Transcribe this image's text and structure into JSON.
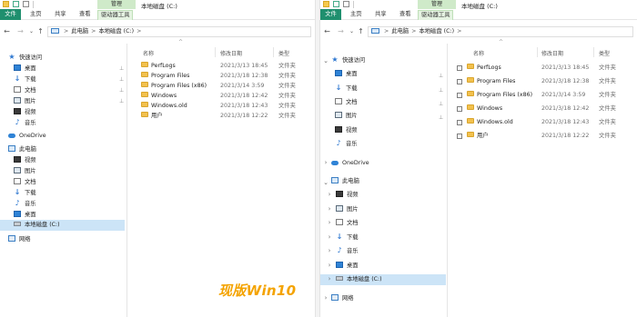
{
  "watermark": "现版Win10",
  "colors": {
    "file_tab": "#1f8f6e",
    "selected": "#cce4f7",
    "folder": "#f2c14e",
    "watermark": "#f4a300",
    "manage_tab": "#cfeac9"
  },
  "left": {
    "title_bar": {
      "manage_tab": "管理",
      "window_title": "本地磁盘 (C:)"
    },
    "tabs": {
      "file": "文件",
      "home": "主页",
      "share": "共享",
      "view": "查看",
      "drive_tools": "驱动器工具"
    },
    "breadcrumb": {
      "root": "此电脑",
      "current": "本地磁盘 (C:)",
      "separator": ">"
    },
    "nav": {
      "quick_access": "快速访问",
      "quick_items": [
        "桌面",
        "下载",
        "文档",
        "图片",
        "视频",
        "音乐"
      ],
      "onedrive": "OneDrive",
      "this_pc": "此电脑",
      "pc_items": [
        "视频",
        "图片",
        "文档",
        "下载",
        "音乐",
        "桌面",
        "本地磁盘 (C:)"
      ],
      "network": "网络"
    },
    "columns": {
      "name": "名称",
      "date": "修改日期",
      "type": "类型"
    },
    "files": [
      {
        "name": "PerfLogs",
        "date": "2021/3/13 18:45",
        "type": "文件夹"
      },
      {
        "name": "Program Files",
        "date": "2021/3/18 12:38",
        "type": "文件夹"
      },
      {
        "name": "Program Files (x86)",
        "date": "2021/3/14 3:59",
        "type": "文件夹"
      },
      {
        "name": "Windows",
        "date": "2021/3/18 12:42",
        "type": "文件夹"
      },
      {
        "name": "Windows.old",
        "date": "2021/3/18 12:43",
        "type": "文件夹"
      },
      {
        "name": "用户",
        "date": "2021/3/18 12:22",
        "type": "文件夹"
      }
    ]
  },
  "right": {
    "title_bar": {
      "manage_tab": "管理",
      "window_title": "本地磁盘 (C:)"
    },
    "tabs": {
      "file": "文件",
      "home": "主页",
      "share": "共享",
      "view": "查看",
      "drive_tools": "驱动器工具"
    },
    "breadcrumb": {
      "root": "此电脑",
      "current": "本地磁盘 (C:)",
      "separator": ">"
    },
    "nav": {
      "quick_access": "快速访问",
      "quick_items": [
        "桌面",
        "下载",
        "文档",
        "图片",
        "视频",
        "音乐"
      ],
      "onedrive": "OneDrive",
      "this_pc": "此电脑",
      "pc_items": [
        "视频",
        "图片",
        "文档",
        "下载",
        "音乐",
        "桌面",
        "本地磁盘 (C:)"
      ],
      "network": "网络"
    },
    "columns": {
      "name": "名称",
      "date": "修改日期",
      "type": "类型"
    },
    "files": [
      {
        "name": "PerfLogs",
        "date": "2021/3/13 18:45",
        "type": "文件夹"
      },
      {
        "name": "Program Files",
        "date": "2021/3/18 12:38",
        "type": "文件夹"
      },
      {
        "name": "Program Files (x86)",
        "date": "2021/3/14 3:59",
        "type": "文件夹"
      },
      {
        "name": "Windows",
        "date": "2021/3/18 12:42",
        "type": "文件夹"
      },
      {
        "name": "Windows.old",
        "date": "2021/3/18 12:43",
        "type": "文件夹"
      },
      {
        "name": "用户",
        "date": "2021/3/18 12:22",
        "type": "文件夹"
      }
    ]
  }
}
